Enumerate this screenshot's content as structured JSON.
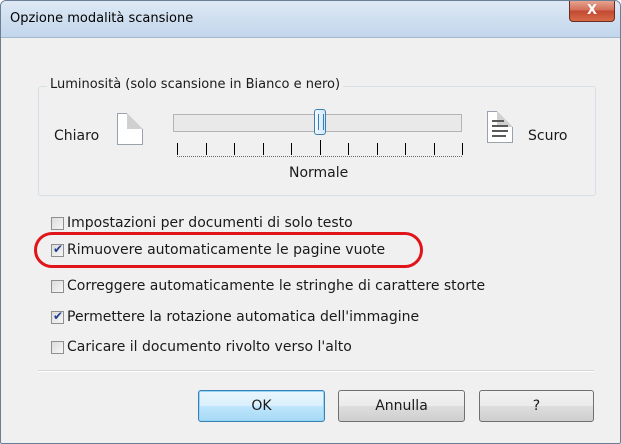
{
  "window": {
    "title": "Opzione modalità scansione",
    "close_glyph": "X"
  },
  "brightness": {
    "group_label": "Luminosità (solo scansione in Bianco e nero)",
    "light_label": "Chiaro",
    "dark_label": "Scuro",
    "center_label": "Normale",
    "level_percent": 50,
    "light_icon": "blank-document-icon",
    "dark_icon": "text-document-icon"
  },
  "options": [
    {
      "label": "Impostazioni per documenti di solo testo",
      "checked": false
    },
    {
      "label": "Rimuovere automaticamente le pagine vuote",
      "checked": true
    },
    {
      "label": "Correggere automaticamente le stringhe di carattere storte",
      "checked": false
    },
    {
      "label": "Permettere la rotazione automatica dell'immagine",
      "checked": true
    },
    {
      "label": "Caricare il documento rivolto verso l'alto",
      "checked": false
    }
  ],
  "highlight_color": "#e0141b",
  "buttons": {
    "ok": "OK",
    "cancel": "Annulla",
    "help": "?"
  }
}
